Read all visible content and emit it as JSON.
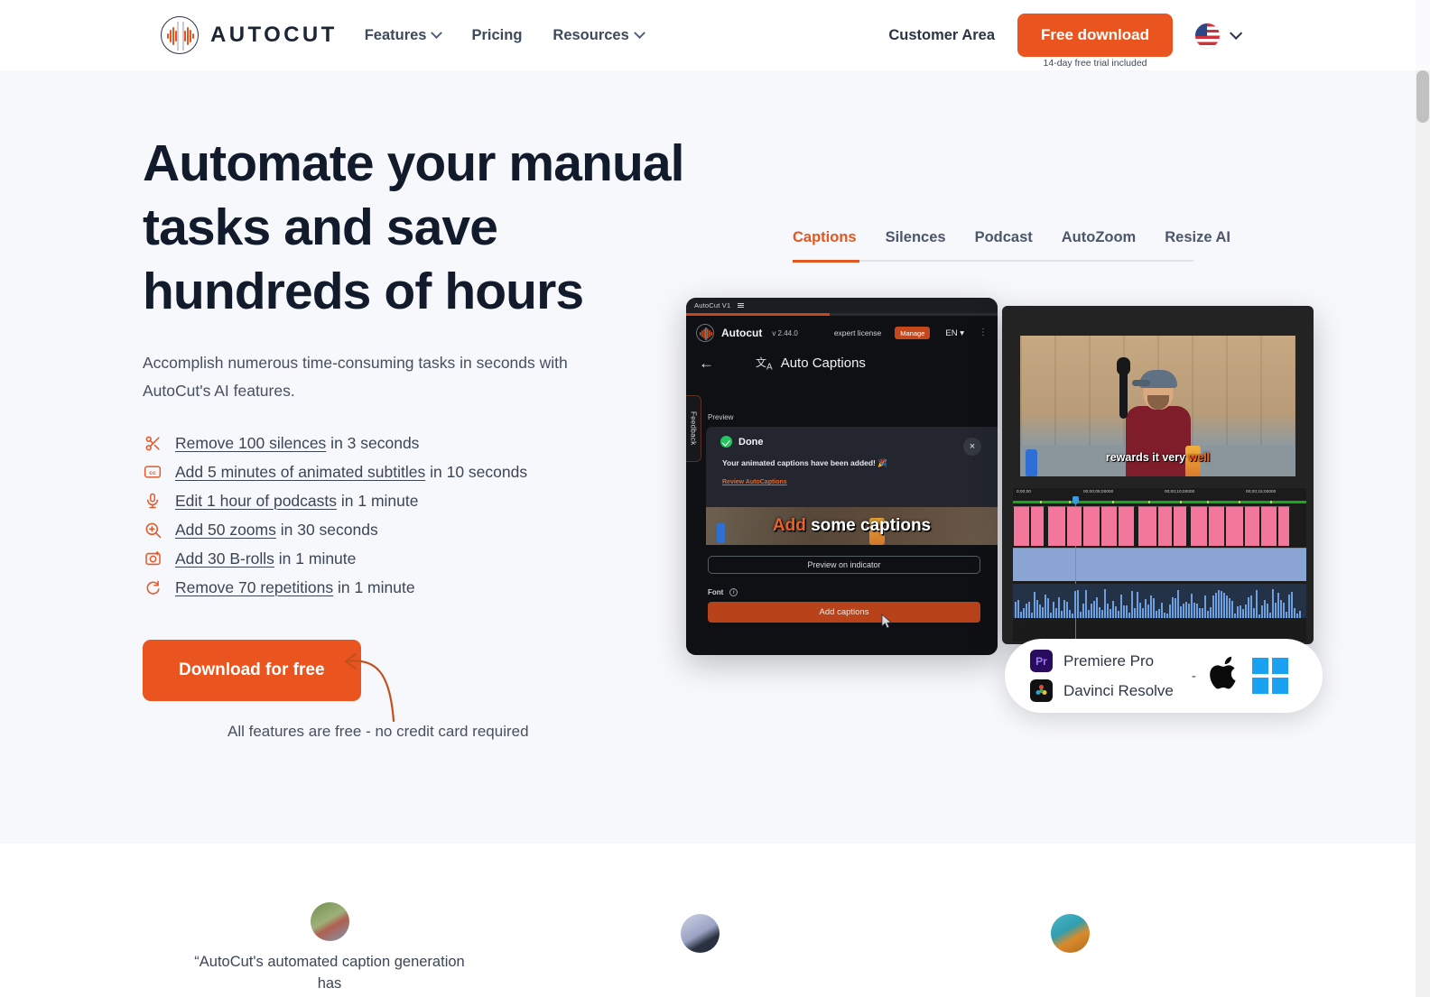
{
  "header": {
    "logo_text": "AUTOCUT",
    "nav": [
      {
        "label": "Features",
        "has_caret": true
      },
      {
        "label": "Pricing",
        "has_caret": false
      },
      {
        "label": "Resources",
        "has_caret": true
      }
    ],
    "customer_area": "Customer Area",
    "free_download": "Free download",
    "trial_note": "14-day free trial included",
    "language_flag": "us-flag-icon"
  },
  "hero": {
    "headline": "Automate your manual tasks and save hundreds of hours",
    "subhead": "Accomplish numerous time-consuming tasks in seconds with AutoCut's AI features.",
    "features": [
      {
        "icon": "scissors-icon",
        "link": "Remove 100 silences",
        "rest": " in 3 seconds"
      },
      {
        "icon": "closed-caption-icon",
        "link": "Add 5 minutes of animated subtitles",
        "rest": " in 10 seconds"
      },
      {
        "icon": "microphone-icon",
        "link": "Edit 1 hour of podcasts",
        "rest": " in 1 minute"
      },
      {
        "icon": "zoom-in-icon",
        "link": "Add 50 zooms",
        "rest": " in 30 seconds"
      },
      {
        "icon": "camera-plus-icon",
        "link": "Add 30 B-rolls",
        "rest": " in 1 minute"
      },
      {
        "icon": "repeat-icon",
        "link": "Remove 70 repetitions",
        "rest": " in 1 minute"
      }
    ],
    "cta_label": "Download for free",
    "cta_note": "All features are free - no credit card required"
  },
  "demo": {
    "tabs": [
      {
        "label": "Captions",
        "active": true
      },
      {
        "label": "Silences",
        "active": false
      },
      {
        "label": "Podcast",
        "active": false
      },
      {
        "label": "AutoZoom",
        "active": false
      },
      {
        "label": "Resize AI",
        "active": false
      }
    ],
    "app": {
      "window_title": "AutoCut V1",
      "brand": "Autocut",
      "version": "v 2.44.0",
      "license": "expert license",
      "manage_label": "Manage",
      "language": "EN",
      "page_title": "Auto Captions",
      "feedback_tab": "Feedback",
      "preview_label": "Preview",
      "modal": {
        "title": "Done",
        "message": "Your animated captions have been added! 🎉",
        "link": "Review AutoCaptions",
        "close": "×"
      },
      "video_caption_highlight": "Add",
      "video_caption_rest": " some captions",
      "preview_button": "Preview on indicator",
      "font_label": "Font",
      "add_captions_button": "Add captions"
    },
    "editor": {
      "caption_rest": "rewards it very ",
      "caption_highlight": "well",
      "ruler_ticks": [
        "0;00;00",
        "00;00;05;00000",
        "00;00;10;00000",
        "00;00;15;00000"
      ]
    },
    "compat": {
      "apps": [
        {
          "name": "Premiere Pro",
          "icon": "premiere-pro-icon",
          "badge": "Pr"
        },
        {
          "name": "Davinci Resolve",
          "icon": "davinci-resolve-icon",
          "badge": ""
        }
      ],
      "separator": "-",
      "os": [
        "apple-icon",
        "windows-icon"
      ]
    }
  },
  "testimonials": [
    {
      "quote": "“AutoCut's automated caption generation has",
      "avatar": "avatar-1"
    },
    {
      "quote": "",
      "avatar": "avatar-2"
    },
    {
      "quote": "",
      "avatar": "avatar-3"
    }
  ],
  "colors": {
    "accent_orange": "#ea551f",
    "hero_bg": "#f7f8fb",
    "text_dark": "#121b2b"
  }
}
